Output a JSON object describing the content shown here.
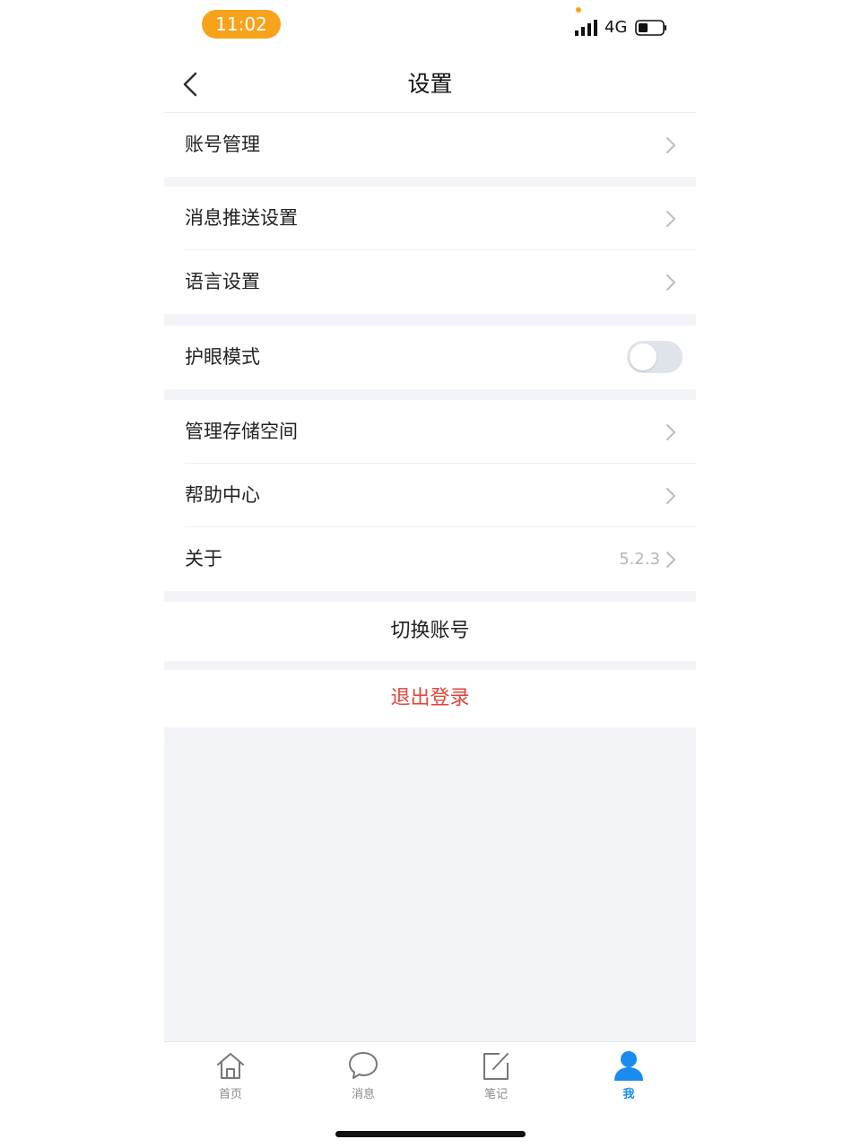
{
  "status_bar": {
    "time": "11:02",
    "network": "4G"
  },
  "nav": {
    "title": "设置"
  },
  "groups": {
    "account": {
      "label": "账号管理"
    },
    "push": {
      "label": "消息推送设置"
    },
    "language": {
      "label": "语言设置"
    },
    "eye_care": {
      "label": "护眼模式",
      "enabled": false
    },
    "storage": {
      "label": "管理存储空间"
    },
    "help": {
      "label": "帮助中心"
    },
    "about": {
      "label": "关于",
      "value": "5.2.3"
    }
  },
  "actions": {
    "switch_account": "切换账号",
    "logout": "退出登录"
  },
  "tabs": [
    {
      "label": "首页",
      "icon": "home-icon",
      "active": false
    },
    {
      "label": "消息",
      "icon": "chat-bubble-icon",
      "active": false
    },
    {
      "label": "笔记",
      "icon": "edit-note-icon",
      "active": false
    },
    {
      "label": "我",
      "icon": "user-icon",
      "active": true
    }
  ],
  "colors": {
    "accent": "#1a8cf0",
    "status_pill": "#f7a21b",
    "danger": "#e0453a",
    "background": "#f3f4f7"
  }
}
